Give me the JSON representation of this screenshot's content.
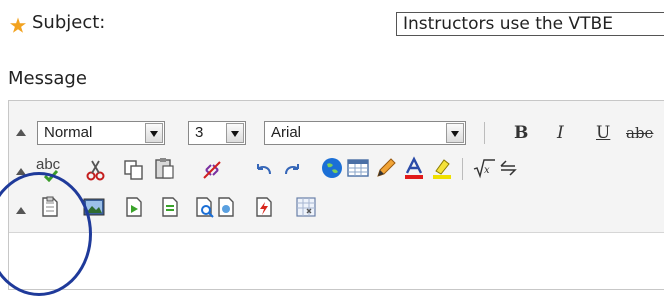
{
  "form": {
    "subject_label": "Subject:",
    "subject_value": "Instructors use the VTBE",
    "message_label": "Message"
  },
  "toolbar": {
    "paragraph_format": "Normal",
    "font_size": "3",
    "font_family": "Arial",
    "bold_label": "B",
    "italic_label": "I",
    "underline_label": "U",
    "strikethrough_label": "abe",
    "spellcheck_label": "abc"
  },
  "colors": {
    "required_star": "#f2a21f",
    "highlight_circle": "#1f3a9a",
    "text_color_underline": "#e11a1a",
    "highlight_color_underline": "#f0e000",
    "link_icon": "#1b6fd6"
  }
}
